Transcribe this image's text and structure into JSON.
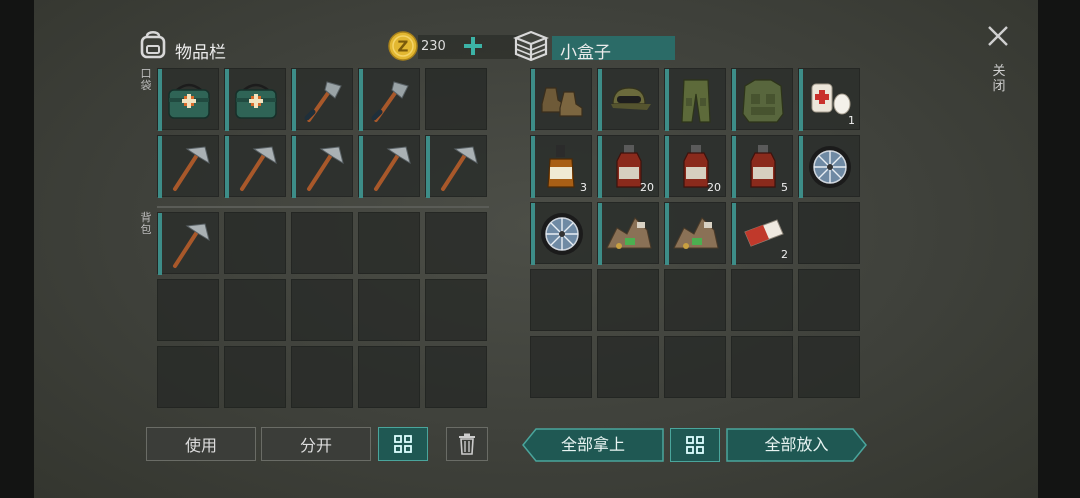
{
  "inventory": {
    "title": "物品栏",
    "currency": "230",
    "coin_symbol": "Z",
    "pocket_label": "口袋",
    "backpack_label": "背包",
    "pocket_slots": [
      {
        "item": "first-aid-kit"
      },
      {
        "item": "first-aid-kit"
      },
      {
        "item": "hatchet"
      },
      {
        "item": "hatchet"
      },
      {
        "item": "empty"
      },
      {
        "item": "pickaxe"
      },
      {
        "item": "pickaxe"
      },
      {
        "item": "pickaxe"
      },
      {
        "item": "pickaxe"
      },
      {
        "item": "pickaxe"
      }
    ],
    "backpack_slots": [
      {
        "item": "pickaxe"
      },
      {
        "item": "empty"
      },
      {
        "item": "empty"
      },
      {
        "item": "empty"
      },
      {
        "item": "empty"
      },
      {
        "item": "empty"
      },
      {
        "item": "empty"
      },
      {
        "item": "empty"
      },
      {
        "item": "empty"
      },
      {
        "item": "empty"
      },
      {
        "item": "empty"
      },
      {
        "item": "empty"
      },
      {
        "item": "empty"
      },
      {
        "item": "empty"
      },
      {
        "item": "empty"
      }
    ],
    "buttons": {
      "use": "使用",
      "split": "分开"
    }
  },
  "container": {
    "title": "小盒子",
    "slots": [
      {
        "item": "boots",
        "count": ""
      },
      {
        "item": "cap",
        "count": ""
      },
      {
        "item": "pants",
        "count": ""
      },
      {
        "item": "vest",
        "count": ""
      },
      {
        "item": "bandage",
        "count": "1"
      },
      {
        "item": "whiskey",
        "count": "3"
      },
      {
        "item": "bottle",
        "count": "20"
      },
      {
        "item": "bottle",
        "count": "20"
      },
      {
        "item": "bottle",
        "count": "5"
      },
      {
        "item": "wheel",
        "count": ""
      },
      {
        "item": "wheel",
        "count": ""
      },
      {
        "item": "scrap",
        "count": ""
      },
      {
        "item": "scrap",
        "count": ""
      },
      {
        "item": "cigarettes",
        "count": "2"
      },
      {
        "item": "empty",
        "count": ""
      },
      {
        "item": "empty",
        "count": ""
      },
      {
        "item": "empty",
        "count": ""
      },
      {
        "item": "empty",
        "count": ""
      },
      {
        "item": "empty",
        "count": ""
      },
      {
        "item": "empty",
        "count": ""
      },
      {
        "item": "empty",
        "count": ""
      },
      {
        "item": "empty",
        "count": ""
      },
      {
        "item": "empty",
        "count": ""
      },
      {
        "item": "empty",
        "count": ""
      },
      {
        "item": "empty",
        "count": ""
      }
    ],
    "buttons": {
      "take_all": "全部拿上",
      "put_all": "全部放入"
    }
  },
  "close_label": "关闭",
  "colors": {
    "accent": "#3d8d88",
    "button_teal": "#1f5853",
    "coin": "#e2b731"
  }
}
